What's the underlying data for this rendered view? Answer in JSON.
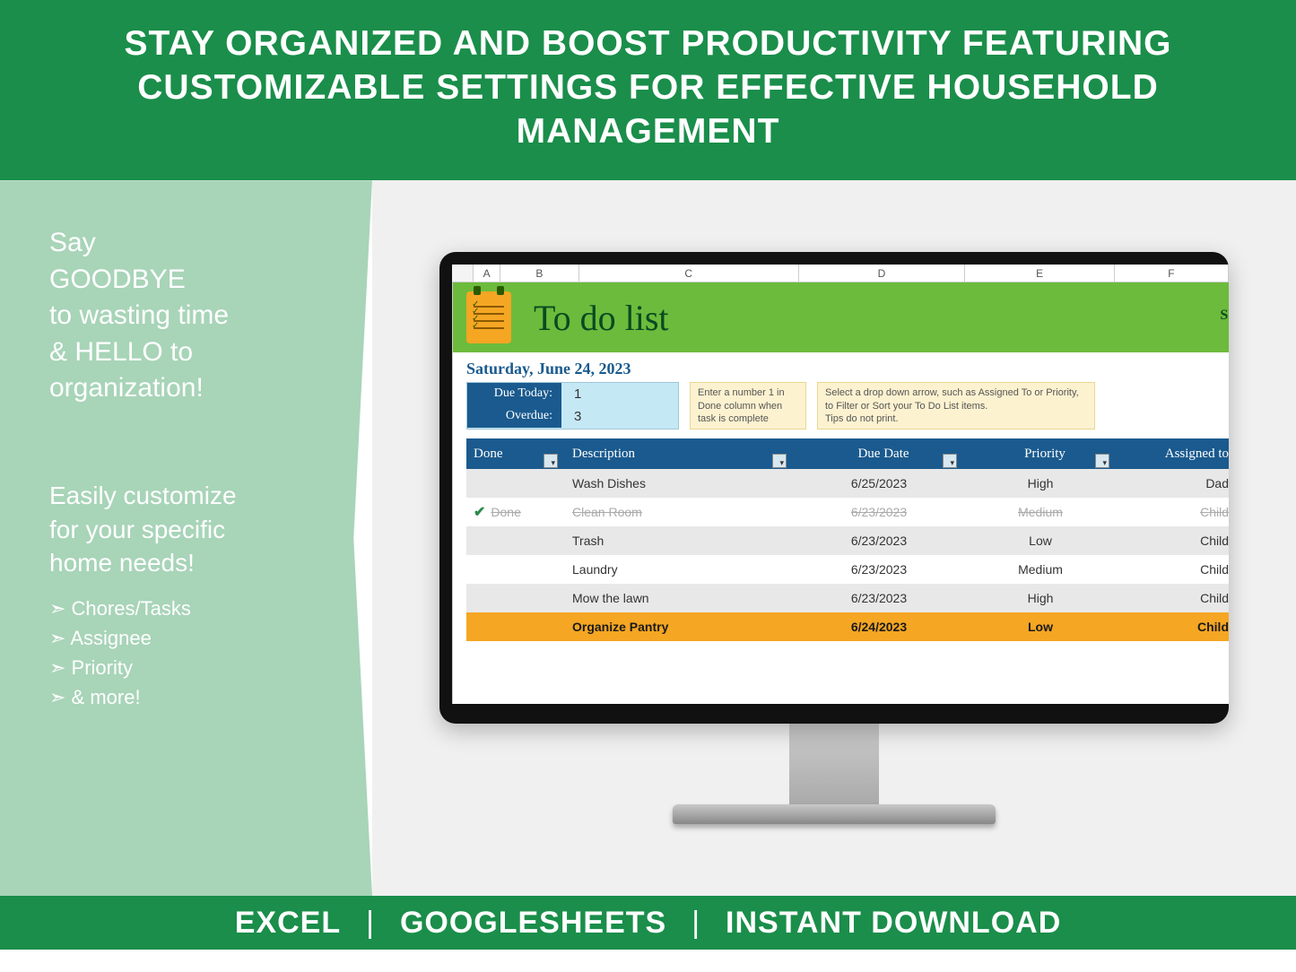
{
  "banner_top": "STAY ORGANIZED AND BOOST PRODUCTIVITY FEATURING CUSTOMIZABLE SETTINGS FOR EFFECTIVE HOUSEHOLD MANAGEMENT",
  "left": {
    "line1": "Say",
    "line2": "GOODBYE",
    "line3": "to wasting time",
    "line4": "& HELLO to",
    "line5": "organization!",
    "block2a": "Easily customize",
    "block2b": "for your specific",
    "block2c": "home needs!",
    "bullets": [
      "Chores/Tasks",
      "Assignee",
      "Priority",
      "& more!"
    ]
  },
  "spreadsheet": {
    "cols": [
      "A",
      "B",
      "C",
      "D",
      "E",
      "F"
    ],
    "title": "To do list",
    "se": "SE",
    "date": "Saturday, June 24, 2023",
    "due_today_label": "Due Today:",
    "due_today_val": "1",
    "overdue_label": "Overdue:",
    "overdue_val": "3",
    "tip1": "Enter a number 1 in Done column when task is complete",
    "tip2": "Select a drop down arrow, such as Assigned To or Priority, to Filter or Sort your To Do List items.\nTips do not print.",
    "headers": {
      "done": "Done",
      "desc": "Description",
      "date": "Due Date",
      "prio": "Priority",
      "asgn": "Assigned to"
    },
    "rows": [
      {
        "done": "",
        "desc": "Wash Dishes",
        "date": "6/25/2023",
        "prio": "High",
        "asgn": "Dad",
        "alt": true
      },
      {
        "done": "Done",
        "check": true,
        "desc": "Clean Room",
        "date": "6/23/2023",
        "prio": "Medium",
        "asgn": "Child",
        "strike": true
      },
      {
        "done": "",
        "desc": "Trash",
        "date": "6/23/2023",
        "prio": "Low",
        "asgn": "Child",
        "alt": true
      },
      {
        "done": "",
        "desc": "Laundry",
        "date": "6/23/2023",
        "prio": "Medium",
        "asgn": "Child"
      },
      {
        "done": "",
        "desc": "Mow the lawn",
        "date": "6/23/2023",
        "prio": "High",
        "asgn": "Child",
        "alt": true
      },
      {
        "done": "",
        "desc": "Organize Pantry",
        "date": "6/24/2023",
        "prio": "Low",
        "asgn": "Child",
        "highlight": true
      }
    ]
  },
  "banner_bottom": {
    "a": "EXCEL",
    "b": "GOOGLESHEETS",
    "c": "INSTANT DOWNLOAD"
  }
}
